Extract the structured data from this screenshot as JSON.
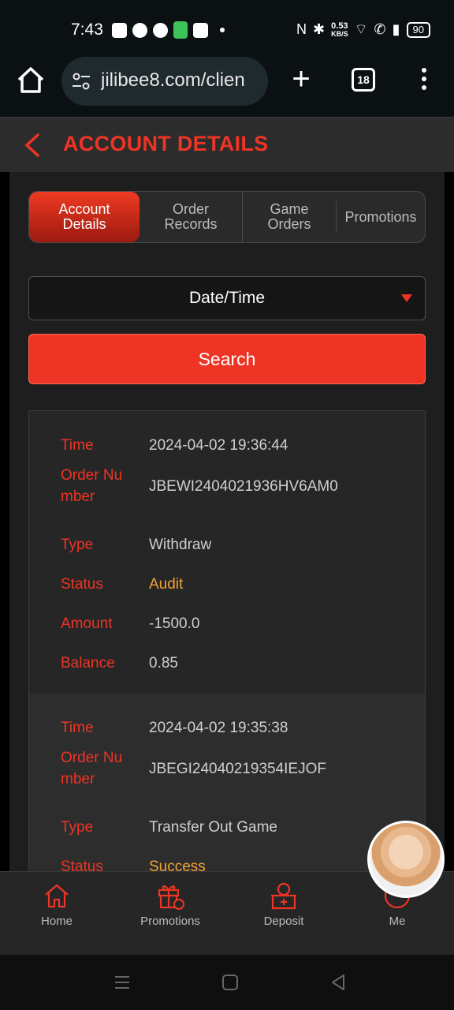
{
  "status_bar": {
    "time": "7:43",
    "net_speed_value": "0.53",
    "net_speed_unit": "KB/S",
    "battery": "90"
  },
  "browser": {
    "url": "jilibee8.com/clien",
    "tab_count": "18"
  },
  "header": {
    "title": "ACCOUNT DETAILS"
  },
  "tabs": [
    {
      "label": "Account Details",
      "active": true
    },
    {
      "label": "Order Records",
      "active": false
    },
    {
      "label": "Game Orders",
      "active": false
    },
    {
      "label": "Promotions",
      "active": false
    }
  ],
  "filter": {
    "date_label": "Date/Time"
  },
  "search": {
    "label": "Search"
  },
  "records": [
    {
      "time_label": "Time",
      "time": "2024-04-02 19:36:44",
      "order_label": "Order Nu mber",
      "order_number": "JBEWI2404021936HV6AM0",
      "type_label": "Type",
      "type": "Withdraw",
      "status_label": "Status",
      "status": "Audit",
      "amount_label": "Amount",
      "amount": "-1500.0",
      "balance_label": "Balance",
      "balance": "0.85"
    },
    {
      "time_label": "Time",
      "time": "2024-04-02 19:35:38",
      "order_label": "Order Nu mber",
      "order_number": "JBEGI24040219354IEJOF",
      "type_label": "Type",
      "type": "Transfer Out Game",
      "status_label": "Status",
      "status": "Success"
    }
  ],
  "bottom_nav": [
    {
      "label": "Home",
      "icon": "home-icon"
    },
    {
      "label": "Promotions",
      "icon": "gift-icon"
    },
    {
      "label": "Deposit",
      "icon": "deposit-icon"
    },
    {
      "label": "Me",
      "icon": "user-icon"
    }
  ],
  "colors": {
    "accent": "#ee3425",
    "status_orange": "#f4a233",
    "background": "#1e1e1e"
  }
}
